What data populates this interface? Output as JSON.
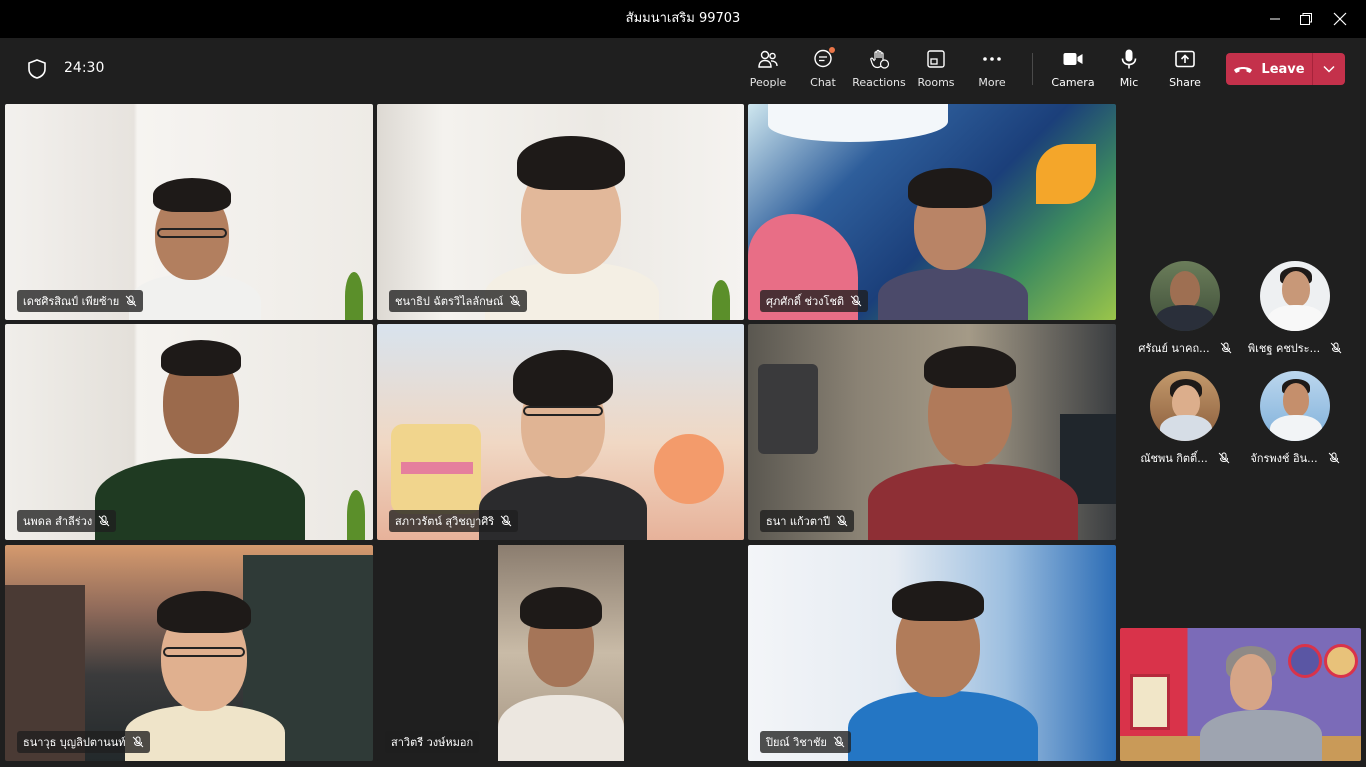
{
  "window": {
    "title": "สัมมนาเสริม 99703",
    "controls": [
      "minimize",
      "maximize",
      "close"
    ]
  },
  "meeting": {
    "timer": "24:30"
  },
  "toolbar": {
    "people_label": "People",
    "chat_label": "Chat",
    "reactions_label": "Reactions",
    "rooms_label": "Rooms",
    "more_label": "More",
    "camera_label": "Camera",
    "mic_label": "Mic",
    "share_label": "Share",
    "leave_label": "Leave"
  },
  "participants": [
    {
      "name": "เดชศิรสิณป์ เพียซ้าย",
      "muted": true
    },
    {
      "name": "ชนาธิป ฉัตรวิไลลักษณ์",
      "muted": true
    },
    {
      "name": "ศุภศักดิ์ ช่วงโชติ",
      "muted": true
    },
    {
      "name": "นพดล สำลีร่วง",
      "muted": true
    },
    {
      "name": "สภาวรัตน์ สุวิชญาศิริ",
      "muted": true
    },
    {
      "name": "ธนา แก้วตาปี",
      "muted": true
    },
    {
      "name": "ธนาวุธ บุญลิปตานนท์",
      "muted": true
    },
    {
      "name": "สาวิตรี วงษ์หมอก",
      "muted": false
    },
    {
      "name": "ปิยณ์ วิชาชัย",
      "muted": true
    }
  ],
  "sidebar_participants": [
    {
      "name": "ศรัณย์ นาคถ...",
      "muted": true
    },
    {
      "name": "พิเชฐ คชประ...",
      "muted": true
    },
    {
      "name": "ณัชพน กิตติ์...",
      "muted": true
    },
    {
      "name": "จักรพงช์ อิน...",
      "muted": true
    }
  ],
  "colors": {
    "leave": "#c4314b",
    "background": "#1f1f1f",
    "titlebar": "#000000"
  }
}
